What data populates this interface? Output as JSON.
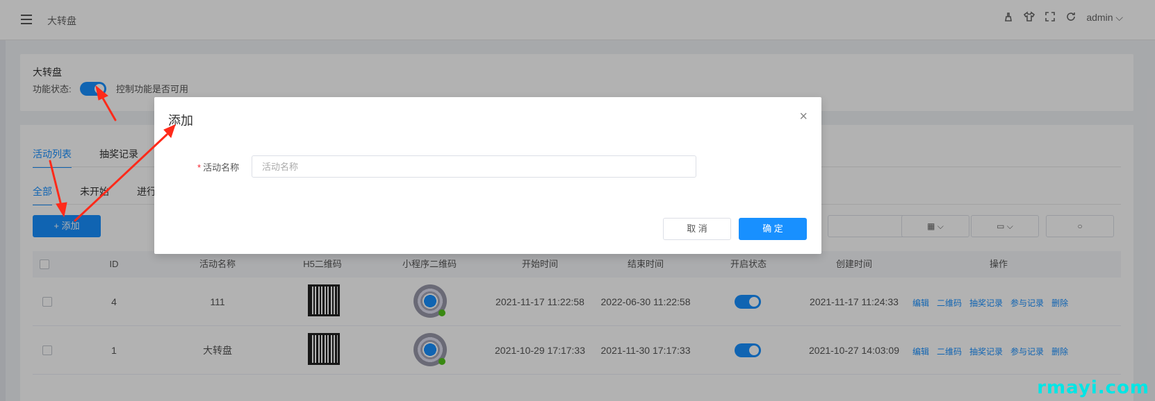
{
  "header": {
    "breadcrumb": "大转盘",
    "user": "admin",
    "icons": [
      "menu-icon",
      "brush-icon",
      "shirt-icon",
      "fullscreen-icon",
      "refresh-icon",
      "chevron-down-icon"
    ]
  },
  "feature": {
    "title": "大转盘",
    "status_label": "功能状态:",
    "status_on": true,
    "hint": "控制功能是否可用"
  },
  "main_tabs": [
    "活动列表",
    "抽奖记录"
  ],
  "sub_tabs": [
    "全部",
    "未开始",
    "进行"
  ],
  "add_button": "+ 添加",
  "table": {
    "columns": [
      "ID",
      "活动名称",
      "H5二维码",
      "小程序二维码",
      "开始时间",
      "结束时间",
      "开启状态",
      "创建时间",
      "操作"
    ],
    "rows": [
      {
        "id": "4",
        "name": "111",
        "start": "2021-11-17 11:22:58",
        "end": "2022-06-30 11:22:58",
        "enabled": true,
        "created": "2021-11-17 11:24:33"
      },
      {
        "id": "1",
        "name": "大转盘",
        "start": "2021-10-29 17:17:33",
        "end": "2021-11-30 17:17:33",
        "enabled": true,
        "created": "2021-10-27 14:03:09"
      }
    ],
    "actions": [
      "编辑",
      "二维码",
      "抽奖记录",
      "参与记录",
      "删除"
    ]
  },
  "modal": {
    "title": "添加",
    "field_label": "活动名称",
    "field_placeholder": "活动名称",
    "field_value": "",
    "cancel": "取 消",
    "confirm": "确 定"
  },
  "watermark": "rmayi.com",
  "colors": {
    "accent": "#1890ff",
    "annotation": "#ff2a1a",
    "watermark": "#00e5e5"
  }
}
